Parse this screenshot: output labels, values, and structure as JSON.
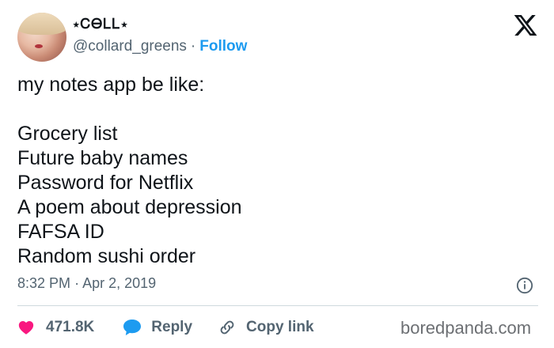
{
  "tweet": {
    "display_name": "⋆ᏟᎾᏞᏞ⋆",
    "handle": "@collard_greens",
    "separator": "·",
    "follow_label": "Follow",
    "text": "my notes app be like:\n\nGrocery list\nFuture baby names\nPassword for Netflix\nA poem about depression\nFAFSA ID\nRandom sushi order",
    "time": "8:32 PM",
    "date_separator": "·",
    "date": "Apr 2, 2019"
  },
  "actions": {
    "likes": "471.8K",
    "reply_label": "Reply",
    "copy_label": "Copy link"
  },
  "watermark": "boredpanda.com",
  "icons": {
    "platform": "x-logo-icon",
    "like": "heart-icon",
    "reply": "speech-bubble-icon",
    "copy": "link-icon",
    "info": "info-icon"
  },
  "colors": {
    "like": "#f91880",
    "reply": "#1d9bf0",
    "link": "#1d9bf0",
    "text": "#0f1419",
    "muted": "#536471"
  }
}
